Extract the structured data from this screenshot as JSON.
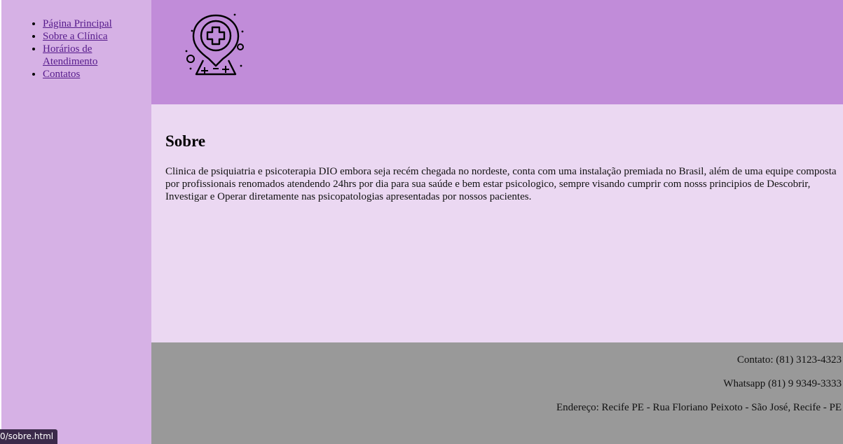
{
  "nav": {
    "items": [
      {
        "label": "Página Principal"
      },
      {
        "label": "Sobre a Clínica"
      },
      {
        "label": "Horários de Atendimento"
      },
      {
        "label": "Contatos"
      }
    ]
  },
  "header": {
    "logo_icon": "medical-location-pin-icon"
  },
  "main": {
    "title": "Sobre",
    "text": "Clinica de psiquiatria e psicoterapia DIO embora seja recém chegada no nordeste, conta com uma instalação premiada no Brasil, além de uma equipe composta por profissionais renomados atendendo 24hrs por dia para sua saúde e bem estar psicologico, sempre visando cumprir com nosss principios de Descobrir, Investigar e Operar diretamente nas psicopatologias apresentadas por nossos pacientes."
  },
  "footer": {
    "contact": "Contato: (81) 3123-4323",
    "whatsapp": "Whatsapp (81) 9 9349-3333",
    "address": "Endereço: Recife PE - Rua Floriano Peixoto - São José, Recife - PE"
  },
  "status_bar": {
    "url": "0/sobre.html"
  },
  "colors": {
    "sidebar": "#d6b1e5",
    "header": "#c18cd9",
    "content": "#ebd8f2",
    "footer": "#999999"
  }
}
